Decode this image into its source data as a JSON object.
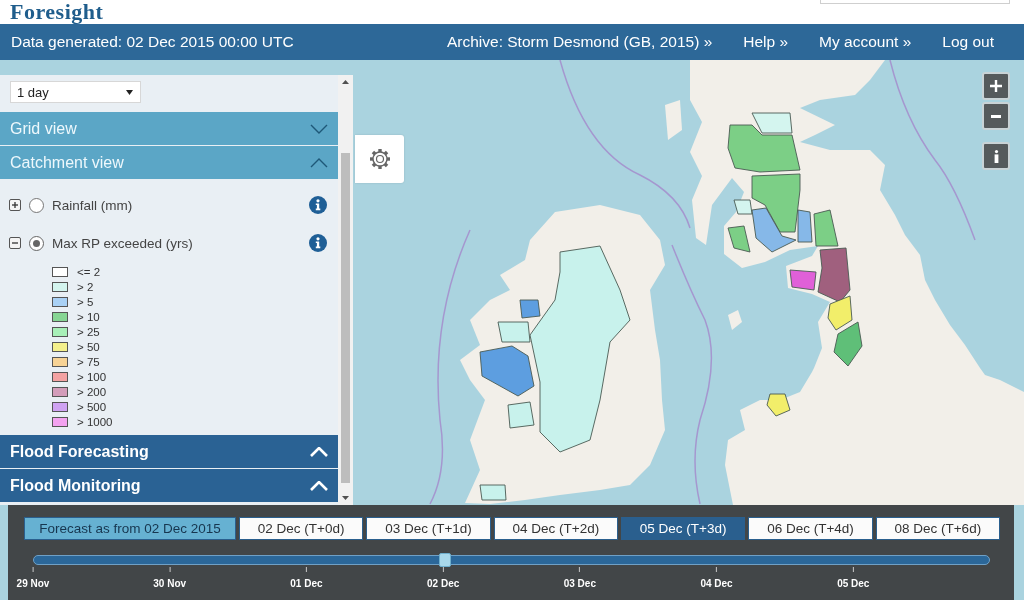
{
  "logo": {
    "text": "Foresight"
  },
  "header": {
    "data_generated": "Data generated: 02 Dec 2015 00:00 UTC",
    "links": [
      {
        "label": "Archive: Storm Desmond (GB, 2015) »"
      },
      {
        "label": "Help »"
      },
      {
        "label": "My account »"
      },
      {
        "label": "Log out"
      }
    ]
  },
  "sidebar": {
    "period": {
      "value": "1 day"
    },
    "sections": [
      {
        "title": "Grid view",
        "kind": "subsection",
        "expanded": false
      },
      {
        "title": "Catchment view",
        "kind": "subsection",
        "expanded": true,
        "layers": [
          {
            "label": "Rainfall (mm)",
            "selected": false,
            "expanded": false
          },
          {
            "label": "Max RP exceeded (yrs)",
            "selected": true,
            "expanded": true,
            "legend": [
              {
                "label": "<= 2",
                "color": "#ffffff"
              },
              {
                "label": "> 2",
                "color": "#d4f5ef"
              },
              {
                "label": "> 5",
                "color": "#a9d1f5"
              },
              {
                "label": "> 10",
                "color": "#86d593"
              },
              {
                "label": "> 25",
                "color": "#a8f0b8"
              },
              {
                "label": "> 50",
                "color": "#f4f08c"
              },
              {
                "label": "> 75",
                "color": "#f7d395"
              },
              {
                "label": "> 100",
                "color": "#f4a3a3"
              },
              {
                "label": "> 200",
                "color": "#d49dba"
              },
              {
                "label": "> 500",
                "color": "#cfa3f2"
              },
              {
                "label": "> 1000",
                "color": "#f4a3f0"
              }
            ]
          }
        ]
      },
      {
        "title": "Flood Forecasting",
        "kind": "group",
        "expanded": true
      },
      {
        "title": "Flood Monitoring",
        "kind": "group",
        "expanded": true
      }
    ]
  },
  "timeline": {
    "forecast_label": "Forecast as from 02 Dec 2015",
    "days": [
      {
        "label": "02 Dec (T+0d)",
        "selected": false
      },
      {
        "label": "03 Dec (T+1d)",
        "selected": false
      },
      {
        "label": "04 Dec (T+2d)",
        "selected": false
      },
      {
        "label": "05 Dec (T+3d)",
        "selected": true
      },
      {
        "label": "06 Dec (T+4d)",
        "selected": false
      },
      {
        "label": "08 Dec (T+6d)",
        "selected": false
      }
    ],
    "slider": {
      "level": 0.43,
      "ticks": [
        "29 Nov",
        "30 Nov",
        "01 Dec",
        "02 Dec",
        "03 Dec",
        "04 Dec",
        "05 Dec"
      ]
    }
  }
}
